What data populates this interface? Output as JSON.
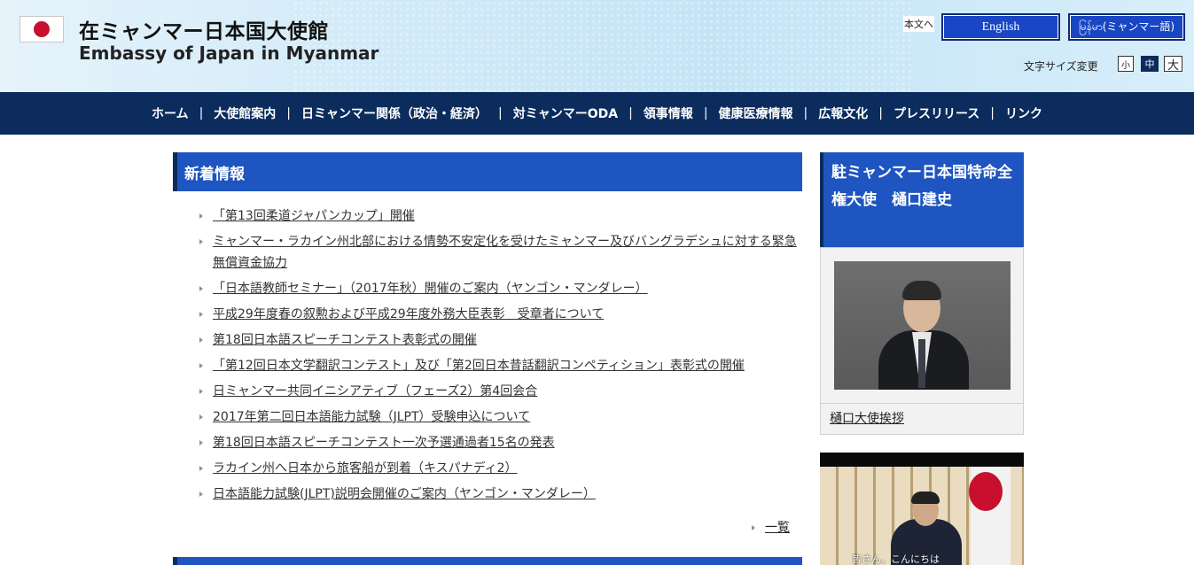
{
  "header": {
    "title_jp": "在ミャンマー日本国大使館",
    "title_en": "Embassy of Japan in Myanmar",
    "skip_link": "本文へ",
    "lang_english": "English",
    "lang_myanmar": "မြန်မာ(ミャンマー語)",
    "font_size_label": "文字サイズ変更",
    "font_size_small": "小",
    "font_size_mid": "中",
    "font_size_large": "大"
  },
  "nav": {
    "items": [
      "ホーム",
      "大使館案内",
      "日ミャンマー関係（政治・経済）",
      "対ミャンマーODA",
      "領事情報",
      "健康医療情報",
      "広報文化",
      "プレスリリース",
      "リンク"
    ],
    "separator": "|"
  },
  "news": {
    "heading": "新着情報",
    "items": [
      "「第13回柔道ジャパンカップ」開催",
      "ミャンマー・ラカイン州北部における情勢不安定化を受けたミャンマー及びバングラデシュに対する緊急無償資金協力",
      "「日本語教師セミナー」（2017年秋）開催のご案内（ヤンゴン・マンダレー）",
      "平成29年度春の叙勲および平成29年度外務大臣表彰　受章者について",
      "第18回日本語スピーチコンテスト表彰式の開催",
      "「第12回日本文学翻訳コンテスト」及び「第2回日本昔話翻訳コンペティション」表彰式の開催",
      "日ミャンマー共同イニシアティブ（フェーズ2）第4回会合",
      "2017年第二回日本語能力試験（JLPT）受験申込について",
      "第18回日本語スピーチコンテスト一次予選通過者15名の発表",
      "ラカイン州へ日本から旅客船が到着（キスパナディ2）",
      "日本語能力試験(JLPT)説明会開催のご案内（ヤンゴン・マンダレー）"
    ],
    "more_link": "一覧"
  },
  "sidebar": {
    "ambassador_heading": "駐ミャンマー日本国特命全権大使　樋口建史",
    "ambassador_link": "樋口大使挨拶",
    "video_caption": "皆さん、こんにちは"
  },
  "colors": {
    "nav_bg": "#0b2c5c",
    "heading_bg": "#1e55c0",
    "flag_red": "#c8102e"
  }
}
